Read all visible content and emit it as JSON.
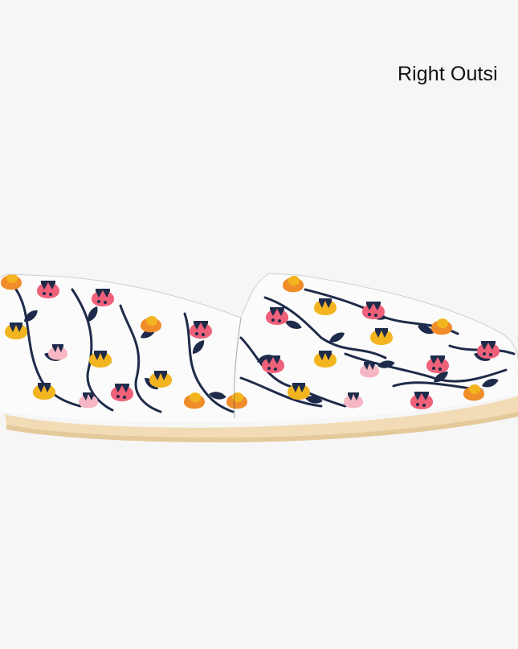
{
  "view_label": "Right Outsi",
  "product_image": {
    "icon": "floral-slip-on-shoe-icon",
    "pattern_colors": {
      "background": "#fbfbfb",
      "navy": "#1e2b4a",
      "yellow": "#f2b51f",
      "orange": "#f08c2a",
      "pink": "#ef6179",
      "light_pink": "#f6b6c3"
    },
    "sole_color": "#f1dcb6"
  }
}
